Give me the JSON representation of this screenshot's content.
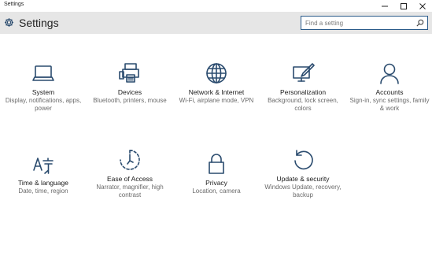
{
  "window": {
    "title": "Settings"
  },
  "header": {
    "title": "Settings"
  },
  "search": {
    "placeholder": "Find a setting"
  },
  "tiles": [
    {
      "label": "System",
      "desc": "Display, notifications, apps, power"
    },
    {
      "label": "Devices",
      "desc": "Bluetooth, printers, mouse"
    },
    {
      "label": "Network & Internet",
      "desc": "Wi-Fi, airplane mode, VPN"
    },
    {
      "label": "Personalization",
      "desc": "Background, lock screen, colors"
    },
    {
      "label": "Accounts",
      "desc": "Sign-in, sync settings, family & work"
    },
    {
      "label": "Time & language",
      "desc": "Date, time, region"
    },
    {
      "label": "Ease of Access",
      "desc": "Narrator, magnifier, high contrast"
    },
    {
      "label": "Privacy",
      "desc": "Location, camera"
    },
    {
      "label": "Update & security",
      "desc": "Windows Update, recovery, backup"
    }
  ],
  "colors": {
    "accent": "#2a4b6e",
    "header_bg": "#e6e6e6"
  }
}
